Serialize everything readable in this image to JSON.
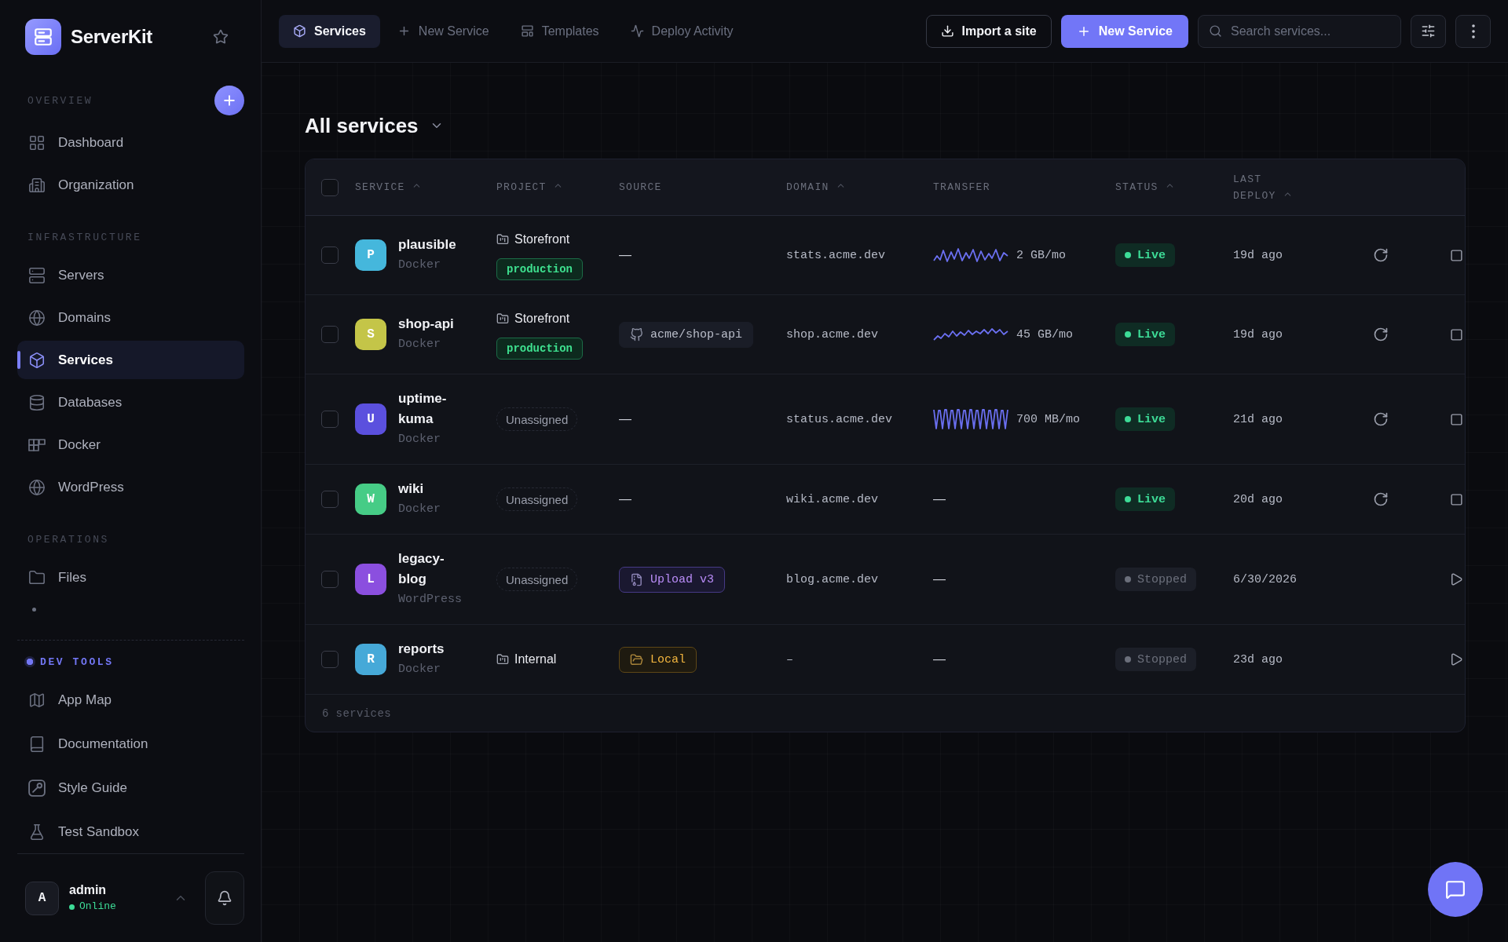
{
  "sidebar": {
    "brand": "ServerKit",
    "sections": [
      {
        "kind": "plain",
        "title": "OVERVIEW",
        "add_button": true,
        "items": [
          {
            "label": "Dashboard",
            "selected": false
          },
          {
            "label": "Organization",
            "selected": false
          }
        ]
      },
      {
        "kind": "plain",
        "title": "INFRASTRUCTURE",
        "items": [
          {
            "label": "Servers",
            "selected": false
          },
          {
            "label": "Domains",
            "selected": false
          },
          {
            "label": "Services",
            "selected": true
          },
          {
            "label": "Databases",
            "selected": false
          },
          {
            "label": "Docker",
            "selected": false
          },
          {
            "label": "WordPress",
            "selected": false
          }
        ]
      },
      {
        "kind": "plain",
        "title": "OPERATIONS",
        "trailing_mark": true,
        "items": [
          {
            "label": "Files",
            "selected": false
          }
        ]
      },
      {
        "kind": "dev",
        "title": "DEV TOOLS",
        "items": [
          {
            "label": "App Map",
            "selected": false
          },
          {
            "label": "Documentation",
            "selected": false
          },
          {
            "label": "Style Guide",
            "selected": false
          },
          {
            "label": "Test Sandbox",
            "selected": false
          }
        ]
      }
    ],
    "user": {
      "initial": "A",
      "name": "admin",
      "status": "Online",
      "online": true
    }
  },
  "top_bar": {
    "tabs": [
      {
        "label": "Services",
        "selected": true
      },
      {
        "label": "New Service",
        "selected": false
      },
      {
        "label": "Templates",
        "selected": false
      },
      {
        "label": "Deploy Activity",
        "selected": false
      }
    ],
    "import_button": "Import a site",
    "primary_button": "New Service",
    "search": {
      "placeholder": "Search services..."
    }
  },
  "page": {
    "title": "All services"
  },
  "table": {
    "select_all": {
      "checked": false
    },
    "columns": [
      {
        "label": "SERVICE",
        "sortable": true
      },
      {
        "label": "PROJECT",
        "sortable": true
      },
      {
        "label": "SOURCE",
        "sortable": false
      },
      {
        "label": "DOMAIN",
        "sortable": true
      },
      {
        "label": "TRANSFER",
        "sortable": false
      },
      {
        "label": "STATUS",
        "sortable": true
      },
      {
        "label": "LAST DEPLOY",
        "sortable": true
      }
    ],
    "rows": [
      {
        "checked": false,
        "avatar": {
          "letter": "P",
          "color": "#45b7dc"
        },
        "name": "plausible",
        "type": "Docker",
        "project": {
          "kind": "project",
          "name": "Storefront",
          "environment": "production"
        },
        "source": {
          "kind": "none",
          "text": "—"
        },
        "domain": "stats.acme.dev",
        "transfer": {
          "kind": "sparkline",
          "reading": "2 GB/mo"
        },
        "status": {
          "kind": "live",
          "label": "Live"
        },
        "last_deploy": "19d ago"
      },
      {
        "checked": false,
        "avatar": {
          "letter": "S",
          "color": "#c4c548"
        },
        "name": "shop-api",
        "type": "Docker",
        "project": {
          "kind": "project",
          "name": "Storefront",
          "environment": "production"
        },
        "source": {
          "kind": "repo",
          "text": "acme/shop-api"
        },
        "domain": "shop.acme.dev",
        "transfer": {
          "kind": "sparkline",
          "reading": "45 GB/mo"
        },
        "status": {
          "kind": "live",
          "label": "Live"
        },
        "last_deploy": "19d ago"
      },
      {
        "checked": false,
        "avatar": {
          "letter": "U",
          "color": "#5b50de"
        },
        "name": "uptime-kuma",
        "type": "Docker",
        "project": {
          "kind": "unassigned",
          "name": "Unassigned"
        },
        "source": {
          "kind": "none",
          "text": "—"
        },
        "domain": "status.acme.dev",
        "transfer": {
          "kind": "sparkline",
          "reading": "700 MB/mo"
        },
        "status": {
          "kind": "live",
          "label": "Live"
        },
        "last_deploy": "21d ago"
      },
      {
        "checked": false,
        "avatar": {
          "letter": "W",
          "color": "#46cc86"
        },
        "name": "wiki",
        "type": "Docker",
        "project": {
          "kind": "unassigned",
          "name": "Unassigned"
        },
        "source": {
          "kind": "none",
          "text": "—"
        },
        "domain": "wiki.acme.dev",
        "transfer": {
          "kind": "none",
          "text": "—"
        },
        "status": {
          "kind": "live",
          "label": "Live"
        },
        "last_deploy": "20d ago"
      },
      {
        "checked": false,
        "avatar": {
          "letter": "L",
          "color": "#8b4fdf"
        },
        "name": "legacy-blog",
        "type": "WordPress",
        "project": {
          "kind": "unassigned",
          "name": "Unassigned"
        },
        "source": {
          "kind": "upload",
          "text": "Upload v3"
        },
        "domain": "blog.acme.dev",
        "transfer": {
          "kind": "none",
          "text": "—"
        },
        "status": {
          "kind": "stopped",
          "label": "Stopped"
        },
        "last_deploy": "6/30/2026"
      },
      {
        "checked": false,
        "avatar": {
          "letter": "R",
          "color": "#46a9d8"
        },
        "name": "reports",
        "type": "Docker",
        "project": {
          "kind": "project",
          "name": "Internal"
        },
        "source": {
          "kind": "local",
          "text": "Local"
        },
        "domain": "–",
        "transfer": {
          "kind": "none",
          "text": "—"
        },
        "status": {
          "kind": "stopped",
          "label": "Stopped"
        },
        "last_deploy": "23d ago"
      }
    ],
    "footer": "6 services"
  }
}
